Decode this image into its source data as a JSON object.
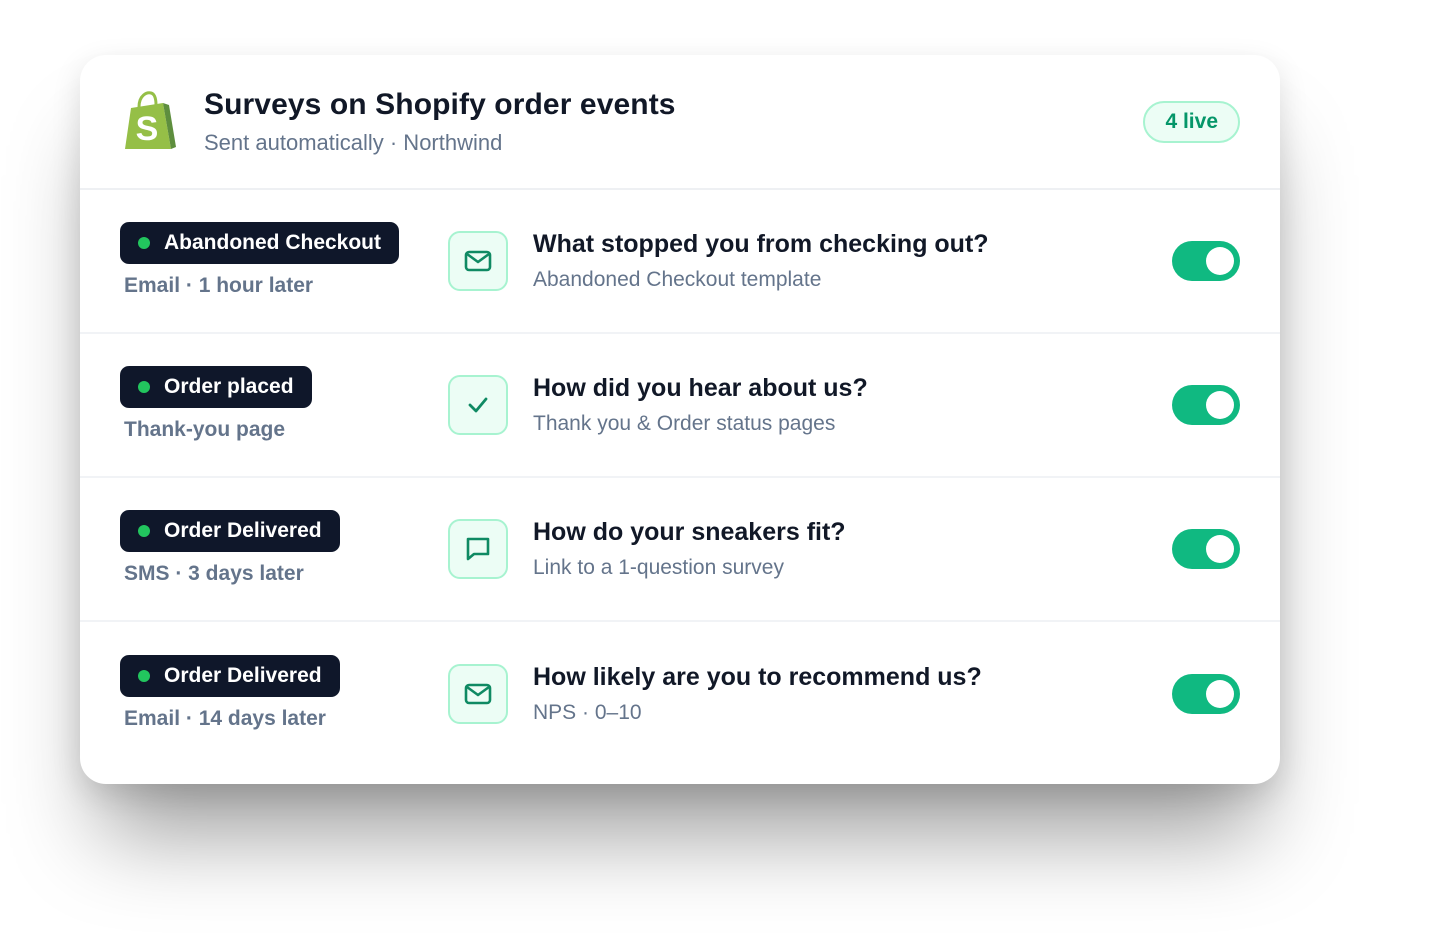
{
  "header": {
    "title": "Surveys on Shopify order events",
    "subtitle": "Sent automatically · Northwind",
    "live_badge": "4 live",
    "logo_letter": "S",
    "logo_icon": "shopify-bag-icon"
  },
  "colors": {
    "accent": "#10b981",
    "accent_light": "#ecfdf5",
    "dark": "#0f172a",
    "dot": "#22c55e",
    "muted": "#64748b"
  },
  "rows": [
    {
      "event": "Abandoned Checkout",
      "timing": "Email · 1 hour later",
      "icon": "mail-icon",
      "question": "What stopped you from checking out?",
      "detail": "Abandoned Checkout template",
      "enabled": true
    },
    {
      "event": "Order placed",
      "timing": "Thank-you page",
      "icon": "check-icon",
      "question": "How did you hear about us?",
      "detail": "Thank you & Order status pages",
      "enabled": true
    },
    {
      "event": "Order Delivered",
      "timing": "SMS · 3 days later",
      "icon": "chat-bubble-icon",
      "question": "How do your sneakers fit?",
      "detail": "Link to a 1-question survey",
      "enabled": true
    },
    {
      "event": "Order Delivered",
      "timing": "Email · 14 days later",
      "icon": "mail-icon",
      "question": "How likely are you to recommend us?",
      "detail": "NPS · 0–10",
      "enabled": true
    }
  ]
}
